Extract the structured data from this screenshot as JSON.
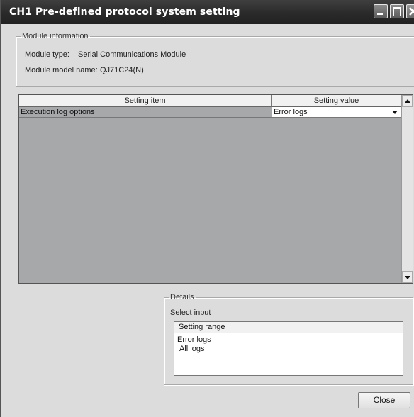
{
  "window": {
    "title": "CH1 Pre-defined protocol system setting"
  },
  "module_info": {
    "legend": "Module information",
    "type_label": "Module type:",
    "type_value": "Serial Communications Module",
    "model_label": "Module model name:",
    "model_value": "QJ71C24(N)"
  },
  "settings_table": {
    "columns": [
      "Setting item",
      "Setting value"
    ],
    "rows": [
      {
        "item": "Execution log options",
        "value": "Error logs"
      }
    ]
  },
  "details": {
    "legend": "Details",
    "subtitle": "Select input",
    "range_header": "Setting range",
    "options": [
      "Error logs",
      "All logs"
    ]
  },
  "buttons": {
    "close": "Close"
  }
}
